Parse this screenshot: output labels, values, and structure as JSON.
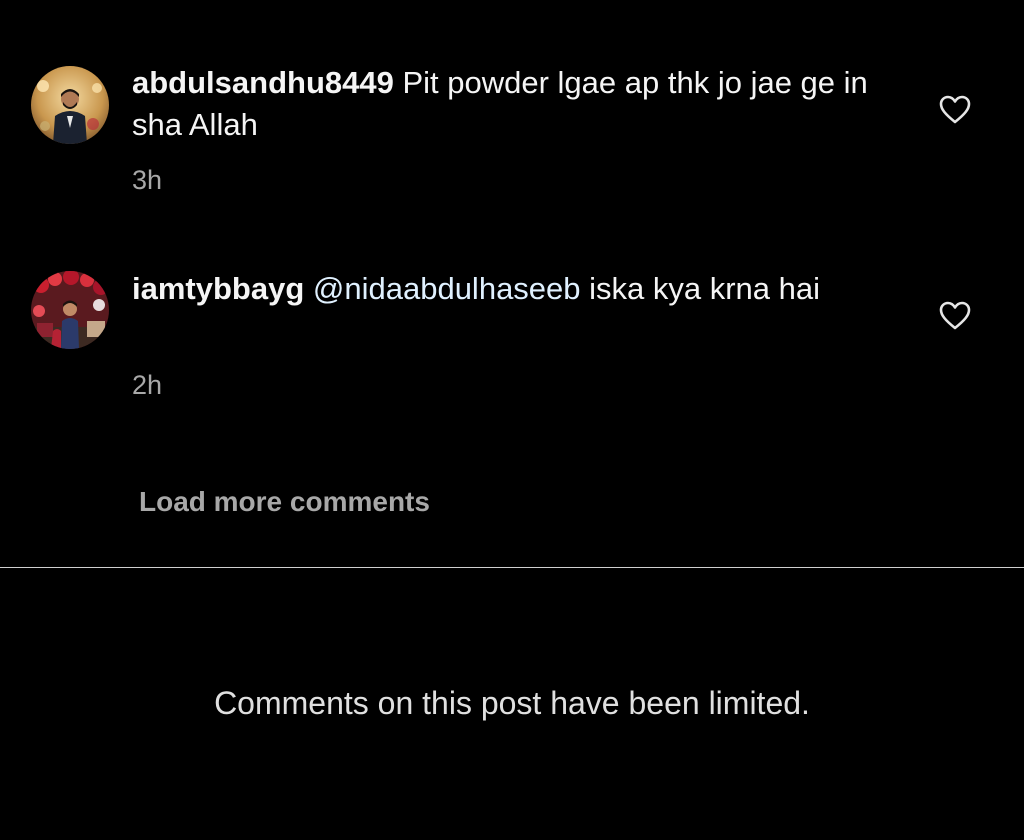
{
  "comments": [
    {
      "username": "abdulsandhu8449",
      "mention": "",
      "text": " Pit powder lgae ap thk jo jae ge in sha Allah",
      "time": "3h"
    },
    {
      "username": "iamtybbayg",
      "mention": " @nidaabdulhaseeb",
      "text": " iska kya krna hai",
      "time": "2h"
    }
  ],
  "load_more_label": "Load more comments",
  "limited_notice": "Comments on this post have been limited.",
  "icons": {
    "like": "heart-outline-icon"
  },
  "colors": {
    "background": "#000000",
    "primary_text": "#f5f5f5",
    "secondary_text": "#a8a8a8",
    "mention": "#e0f1ff"
  }
}
